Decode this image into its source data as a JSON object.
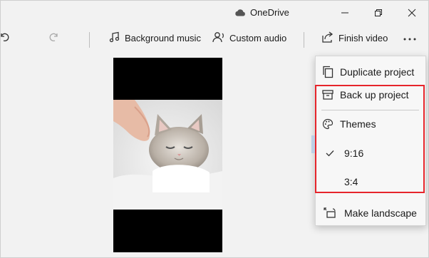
{
  "titlebar": {
    "onedrive_label": "OneDrive"
  },
  "toolbar": {
    "background_music_label": "Background music",
    "custom_audio_label": "Custom audio",
    "finish_video_label": "Finish video",
    "more_label": "..."
  },
  "menu": {
    "items": [
      {
        "label": "Duplicate project",
        "icon": "duplicate-icon"
      },
      {
        "label": "Back up project",
        "icon": "archive-icon"
      },
      {
        "label": "Themes",
        "icon": "palette-icon"
      },
      {
        "label": "9:16",
        "icon": "checkmark-icon",
        "selected": true
      },
      {
        "label": "3:4",
        "icon": "",
        "selected": false
      },
      {
        "label": "Make landscape",
        "icon": "rotate-landscape-icon"
      }
    ]
  },
  "colors": {
    "highlight": "#e6252b",
    "background": "#f2f2f2",
    "menu_background": "#f7f7f7"
  }
}
